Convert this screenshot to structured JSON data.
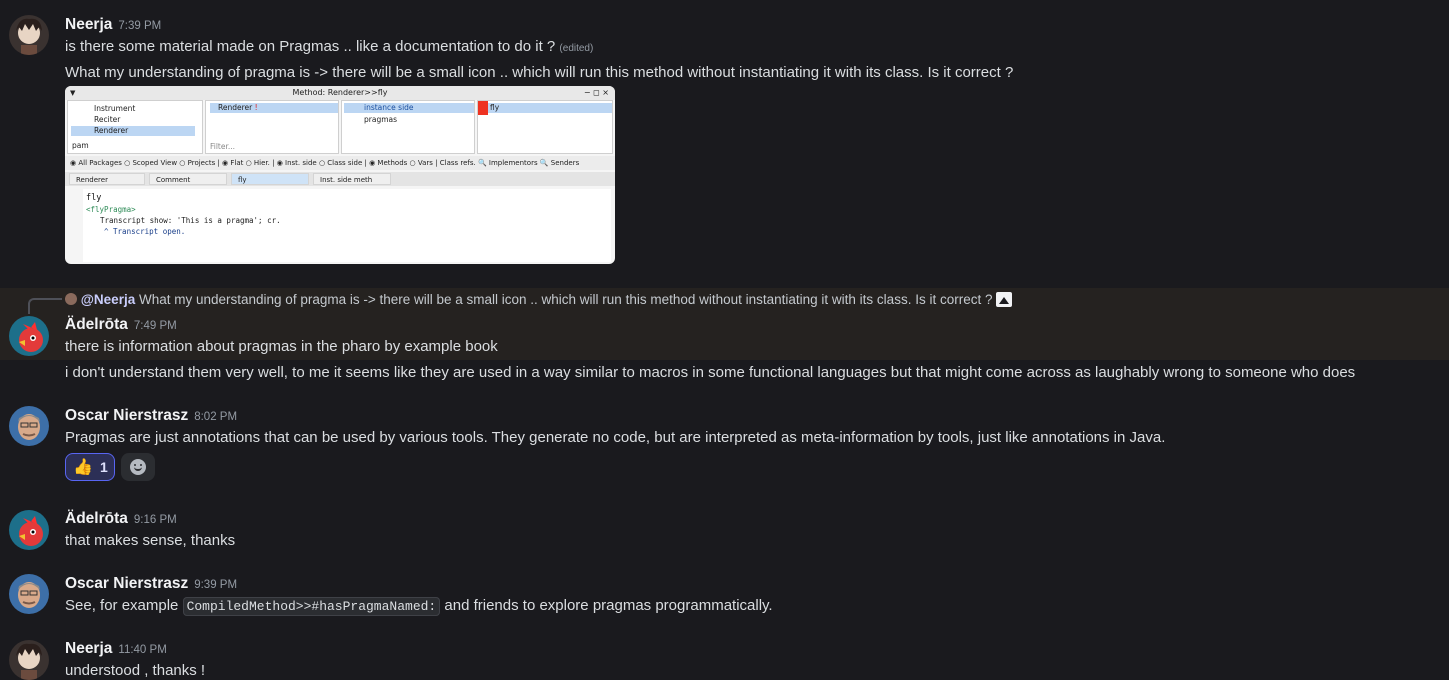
{
  "messages": {
    "m1": {
      "author": "Neerja",
      "time": "7:39 PM",
      "text1": "is there some material made on Pragmas .. like a documentation to do it ?",
      "edited": "(edited)",
      "text2": "What my understanding of pragma is -> there will be a small icon .. which will run this method without instantiating it with its class.  Is it correct ?"
    },
    "m2": {
      "reply_mention": "@Neerja",
      "reply_text": "What my understanding of pragma is -> there will be a small icon .. which will run this method without instantiating it with its class.  Is it correct ?",
      "author": "Ädelrōta",
      "time": "7:49 PM",
      "text1": "there is information about pragmas in the pharo by example book",
      "text2": "i don't understand them very well, to me it seems like they are used in a way similar to macros in some functional languages but that might come across as laughably wrong to someone who does"
    },
    "m3": {
      "author": "Oscar Nierstrasz",
      "time": "8:02 PM",
      "text": "Pragmas are just annotations that can be used by various tools. They generate no code, but are interpreted as meta-information by tools, just like annotations in Java.",
      "reaction_emoji": "👍",
      "reaction_count": "1"
    },
    "m4": {
      "author": "Ädelrōta",
      "time": "9:16 PM",
      "text": "that makes sense, thanks"
    },
    "m5": {
      "author": "Oscar Nierstrasz",
      "time": "9:39 PM",
      "text_before": "See, for example",
      "code": "CompiledMethod>>#hasPragmaNamed:",
      "text_after": "and friends to explore pragmas programmatically."
    },
    "m6": {
      "author": "Neerja",
      "time": "11:40 PM",
      "text": "understood , thanks !"
    }
  },
  "attachment": {
    "window_title": "Method: Renderer>>fly",
    "window_controls": "− ◻ ×",
    "pane1_items": [
      "Instrument",
      "Reciter",
      "Renderer"
    ],
    "pane1_filter": "pam",
    "pane2_item": "Renderer",
    "pane2_filter": "Filter...",
    "pane3_items": [
      "instance side",
      "pragmas"
    ],
    "pane4_item": "fly",
    "toolbar": "◉ All Packages  ○ Scoped View  ○ Projects  |  ◉ Flat  ○ Hier.  |  ◉ Inst. side  ○ Class side  |  ◉ Methods  ○ Vars  |  Class refs.  🔍 Implementors  🔍 Senders",
    "tabs": [
      "Renderer",
      "Comment",
      "fly",
      "Inst. side meth"
    ],
    "code_lines": [
      "fly",
      "<flyPragma>",
      "Transcript show: 'This is a pragma'; cr.",
      "^ Transcript open."
    ]
  },
  "colors": {
    "background": "#1a1a1e",
    "highlight": "#252220",
    "mention": "#c9cdfb",
    "reaction_border": "#5865f2"
  }
}
